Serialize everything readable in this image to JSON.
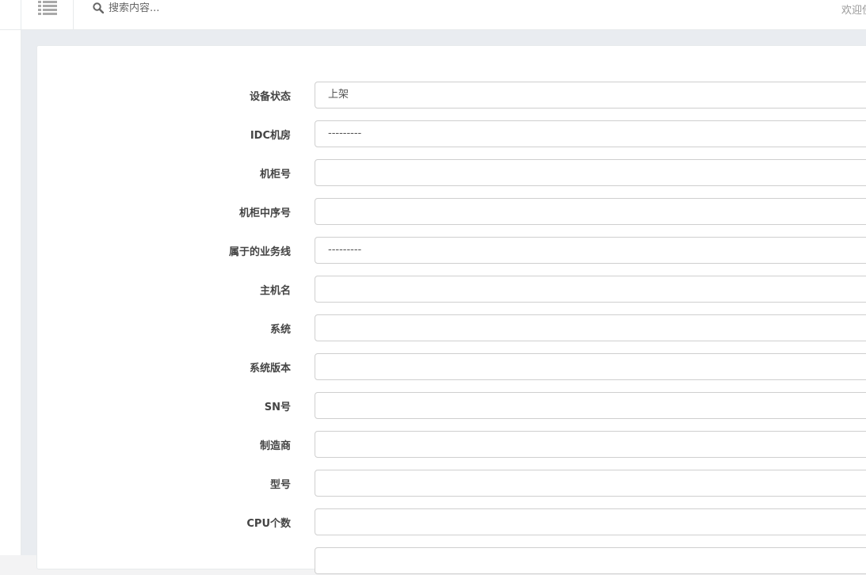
{
  "header": {
    "search_placeholder": "搜索内容...",
    "welcome_text": "欢迎使用"
  },
  "form": {
    "fields": [
      {
        "label": "设备状态",
        "value": "上架"
      },
      {
        "label": "IDC机房",
        "value": "---------"
      },
      {
        "label": "机柜号",
        "value": ""
      },
      {
        "label": "机柜中序号",
        "value": ""
      },
      {
        "label": "属于的业务线",
        "value": "---------"
      },
      {
        "label": "主机名",
        "value": ""
      },
      {
        "label": "系统",
        "value": ""
      },
      {
        "label": "系统版本",
        "value": ""
      },
      {
        "label": "SN号",
        "value": ""
      },
      {
        "label": "制造商",
        "value": ""
      },
      {
        "label": "型号",
        "value": ""
      },
      {
        "label": "CPU个数",
        "value": ""
      },
      {
        "label": "",
        "value": ""
      }
    ]
  },
  "icons": {
    "menu_toggle": "list-icon",
    "search": "search-icon"
  },
  "colors": {
    "page_bg": "#e9ecf0",
    "card_bg": "#ffffff",
    "border": "#cfcfcf"
  }
}
